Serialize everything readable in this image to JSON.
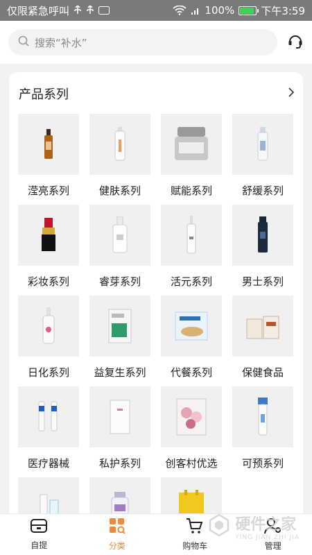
{
  "status_bar": {
    "carrier_text": "仅限紧急呼叫",
    "battery_percent": "100%",
    "time": "下午3:59",
    "battery_color": "#3fd15c"
  },
  "search": {
    "placeholder": "搜索“补水”"
  },
  "section": {
    "title": "产品系列"
  },
  "categories": [
    {
      "label": "滢亮系列",
      "icon": "ampoule"
    },
    {
      "label": "健肤系列",
      "icon": "tube-bottle"
    },
    {
      "label": "赋能系列",
      "icon": "cream-jar"
    },
    {
      "label": "舒缓系列",
      "icon": "spray-bottle"
    },
    {
      "label": "彩妆系列",
      "icon": "lipstick"
    },
    {
      "label": "睿芽系列",
      "icon": "serum-bottle"
    },
    {
      "label": "活元系列",
      "icon": "pump-bottle"
    },
    {
      "label": "男士系列",
      "icon": "dark-bottle"
    },
    {
      "label": "日化系列",
      "icon": "pump-lotion"
    },
    {
      "label": "益复生系列",
      "icon": "supplement-box"
    },
    {
      "label": "代餐系列",
      "icon": "meal-box"
    },
    {
      "label": "保健食品",
      "icon": "health-box"
    },
    {
      "label": "医疗器械",
      "icon": "medical-tubes"
    },
    {
      "label": "私护系列",
      "icon": "care-box"
    },
    {
      "label": "创客村优选",
      "icon": "flower-pack"
    },
    {
      "label": "可预系列",
      "icon": "tube"
    },
    {
      "label": "",
      "icon": "spray"
    },
    {
      "label": "",
      "icon": "jar"
    },
    {
      "label": "",
      "icon": "yellow-bag"
    }
  ],
  "bottom_nav": [
    {
      "label": "自提",
      "icon": "pickup-icon"
    },
    {
      "label": "分类",
      "icon": "category-icon",
      "active": true
    },
    {
      "label": "购物车",
      "icon": "cart-icon"
    },
    {
      "label": "管理",
      "icon": "manage-icon"
    }
  ],
  "watermark": {
    "title": "硬件之家",
    "subtitle": "YING JIAN ZHI JIA"
  },
  "accent_color": "#f08a3b"
}
